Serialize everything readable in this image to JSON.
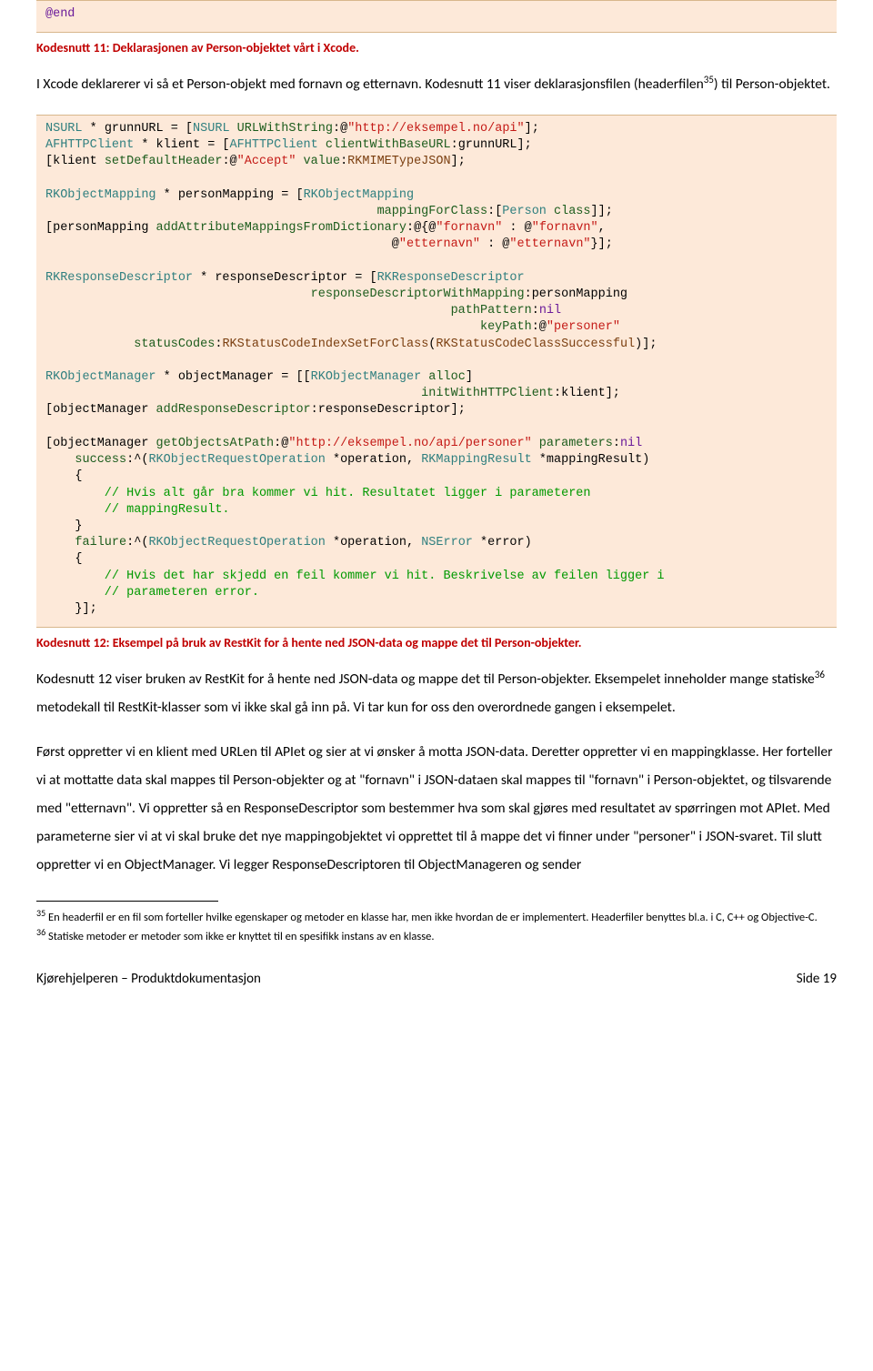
{
  "block1": {
    "end": "@end"
  },
  "caption11": "Kodesnutt 11: Deklarasjonen av Person-objektet vårt i Xcode.",
  "para1": "I Xcode deklarerer vi så et Person-objekt med fornavn og etternavn. Kodesnutt 11 viser deklarasjonsfilen (headerfilen",
  "para1_sup": "35",
  "para1_tail": ") til Person-objektet.",
  "code": {
    "l1a": "NSURL",
    "l1b": " * grunnURL = [",
    "l1c": "NSURL",
    "l1d": " URLWithString",
    "l1e": ":@",
    "l1f": "\"http://eksempel.no/api\"",
    "l1g": "];",
    "l2a": "AFHTTPClient",
    "l2b": " * klient = [",
    "l2c": "AFHTTPClient",
    "l2d": " clientWithBaseURL",
    "l2e": ":grunnURL];",
    "l3a": "[klient ",
    "l3b": "setDefaultHeader",
    "l3c": ":@",
    "l3d": "\"Accept\"",
    "l3e": " value",
    "l3f": ":",
    "l3g": "RKMIMETypeJSON",
    "l3h": "];",
    "l4a": "RKObjectMapping",
    "l4b": " * personMapping = [",
    "l4c": "RKObjectMapping",
    "l5a": "                                             ",
    "l5b": "mappingForClass",
    "l5c": ":[",
    "l5d": "Person",
    "l5e": " class",
    "l5f": "]];",
    "l6a": "[personMapping ",
    "l6b": "addAttributeMappingsFromDictionary",
    "l6c": ":@{@",
    "l6d": "\"fornavn\"",
    "l6e": " : @",
    "l6f": "\"fornavn\"",
    "l6g": ",",
    "l7a": "                                               @",
    "l7b": "\"etternavn\"",
    "l7c": " : @",
    "l7d": "\"etternavn\"",
    "l7e": "}];",
    "l8a": "RKResponseDescriptor",
    "l8b": " * responseDescriptor = [",
    "l8c": "RKResponseDescriptor",
    "l9a": "                                    ",
    "l9b": "responseDescriptorWithMapping",
    "l9c": ":personMapping",
    "l10a": "                                                       ",
    "l10b": "pathPattern",
    "l10c": ":",
    "l10d": "nil",
    "l11a": "                                                           ",
    "l11b": "keyPath",
    "l11c": ":@",
    "l11d": "\"personer\"",
    "l12a": "            ",
    "l12b": "statusCodes",
    "l12c": ":",
    "l12d": "RKStatusCodeIndexSetForClass",
    "l12e": "(",
    "l12f": "RKStatusCodeClassSuccessful",
    "l12g": ")];",
    "l13a": "RKObjectManager",
    "l13b": " * objectManager = [[",
    "l13c": "RKObjectManager",
    "l13d": " alloc",
    "l13e": "]",
    "l14a": "                                                   ",
    "l14b": "initWithHTTPClient",
    "l14c": ":klient];",
    "l15a": "[objectManager ",
    "l15b": "addResponseDescriptor",
    "l15c": ":responseDescriptor];",
    "l16a": "[objectManager ",
    "l16b": "getObjectsAtPath",
    "l16c": ":@",
    "l16d": "\"http://eksempel.no/api/personer\"",
    "l16e": " parameters",
    "l16f": ":",
    "l16g": "nil",
    "l17a": "    ",
    "l17b": "success",
    "l17c": ":^(",
    "l17d": "RKObjectRequestOperation",
    "l17e": " *operation, ",
    "l17f": "RKMappingResult",
    "l17g": " *mappingResult)",
    "l18": "    {",
    "l19": "        // Hvis alt går bra kommer vi hit. Resultatet ligger i parameteren",
    "l20": "        // mappingResult.",
    "l21": "    }",
    "l22a": "    ",
    "l22b": "failure",
    "l22c": ":^(",
    "l22d": "RKObjectRequestOperation",
    "l22e": " *operation, ",
    "l22f": "NSError",
    "l22g": " *error)",
    "l23": "    {",
    "l24": "        // Hvis det har skjedd en feil kommer vi hit. Beskrivelse av feilen ligger i",
    "l25": "        // parameteren error.",
    "l26": "    }];"
  },
  "caption12": "Kodesnutt 12: Eksempel på bruk av RestKit for å hente ned JSON-data og mappe det til Person-objekter.",
  "para2a": "Kodesnutt 12 viser bruken av RestKit for å hente ned JSON-data og mappe det til Person-objekter. Eksempelet inneholder mange statiske",
  "para2_sup": "36",
  "para2b": " metodekall til RestKit-klasser som vi ikke skal gå inn på. Vi tar kun for oss den overordnede gangen i eksempelet.",
  "para3": "Først oppretter vi en klient med URLen til APIet og sier at vi ønsker å motta JSON-data. Deretter oppretter vi en mappingklasse. Her forteller vi at mottatte data skal mappes til Person-objekter og at \"fornavn\" i JSON-dataen skal mappes til \"fornavn\" i Person-objektet, og tilsvarende med \"etternavn\". Vi oppretter så en ResponseDescriptor som bestemmer hva som skal gjøres med resultatet av spørringen mot APIet. Med parameterne sier vi at vi skal bruke det nye mappingobjektet vi opprettet til å mappe det vi finner under \"personer\" i JSON-svaret. Til slutt oppretter vi en ObjectManager. Vi legger ResponseDescriptoren til ObjectManageren og sender",
  "fn35_sup": "35",
  "fn35": " En headerfil er en fil som forteller hvilke egenskaper og metoder en klasse har, men ikke hvordan de er implementert. Headerfiler benyttes bl.a. i C, C++ og Objective-C.",
  "fn36_sup": "36",
  "fn36": " Statiske metoder er metoder som ikke er knyttet til en spesifikk instans av en klasse.",
  "footer_left": "Kjørehjelperen – Produktdokumentasjon",
  "footer_right": "Side 19"
}
